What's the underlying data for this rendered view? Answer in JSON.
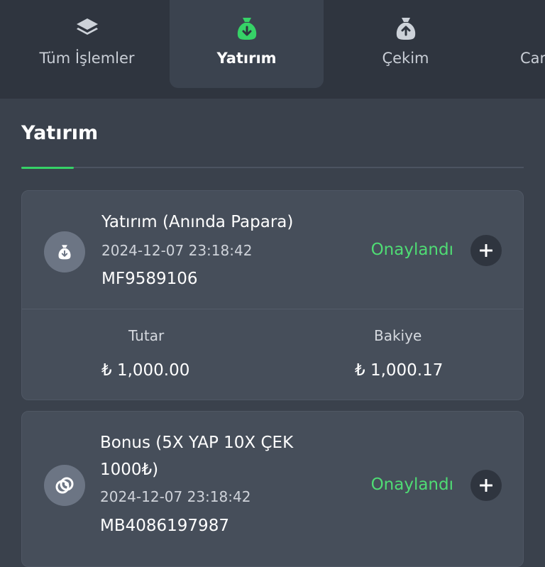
{
  "tabs": [
    {
      "label": "Tüm İşlemler",
      "icon": "layers-icon",
      "active": false
    },
    {
      "label": "Yatırım",
      "icon": "money-bag-down-icon",
      "active": true
    },
    {
      "label": "Çekim",
      "icon": "money-bag-up-icon",
      "active": false
    },
    {
      "label": "Car",
      "icon": "",
      "active": false
    }
  ],
  "section": {
    "title": "Yatırım"
  },
  "colors": {
    "accent": "#36d267",
    "status_green": "#4fdc74",
    "background": "#3a414c",
    "card": "#464e5a"
  },
  "transactions": [
    {
      "icon": "money-bag-down-icon",
      "title": "Yatırım (Anında Papara)",
      "date": "2024-12-07 23:18:42",
      "code": "MF9589106",
      "status": "Onaylandı",
      "amount_label": "Tutar",
      "amount": "₺ 1,000.00",
      "balance_label": "Bakiye",
      "balance": "₺ 1,000.17"
    },
    {
      "icon": "coins-icon",
      "title_line1": "Bonus (5X YAP 10X ÇEK",
      "title_line2": "1000₺)",
      "date": "2024-12-07 23:18:42",
      "code": "MB4086197987",
      "status": "Onaylandı"
    }
  ]
}
